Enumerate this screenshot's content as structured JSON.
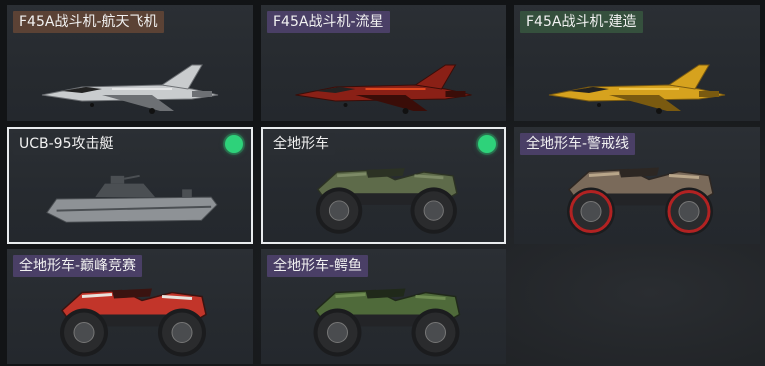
{
  "colors": {
    "tag_brown": "#5b4235",
    "tag_purple": "#4a3f66",
    "tag_green": "#35503d",
    "tag_plain": "#2a2e33",
    "selected_border": "#e9ecee",
    "equipped_dot": "#2ed27a"
  },
  "items": [
    {
      "label": "F45A战斗机-航天飞机",
      "tag": "tag_brown",
      "type": "jet",
      "skin": "white",
      "selected": false,
      "equipped": false
    },
    {
      "label": "F45A战斗机-流星",
      "tag": "tag_purple",
      "type": "jet",
      "skin": "meteor",
      "selected": false,
      "equipped": false
    },
    {
      "label": "F45A战斗机-建造",
      "tag": "tag_green",
      "type": "jet",
      "skin": "yellow",
      "selected": false,
      "equipped": false
    },
    {
      "label": "UCB-95攻击艇",
      "tag": "tag_plain",
      "type": "boat",
      "skin": "grey",
      "selected": true,
      "equipped": true
    },
    {
      "label": "全地形车",
      "tag": "tag_plain",
      "type": "atv",
      "skin": "green",
      "selected": true,
      "equipped": true
    },
    {
      "label": "全地形车-警戒线",
      "tag": "tag_purple",
      "type": "atv",
      "skin": "caution",
      "selected": false,
      "equipped": false
    },
    {
      "label": "全地形车-巅峰竞赛",
      "tag": "tag_purple",
      "type": "atv",
      "skin": "race",
      "selected": false,
      "equipped": false
    },
    {
      "label": "全地形车-鳄鱼",
      "tag": "tag_purple",
      "type": "atv",
      "skin": "croc",
      "selected": false,
      "equipped": false
    }
  ]
}
